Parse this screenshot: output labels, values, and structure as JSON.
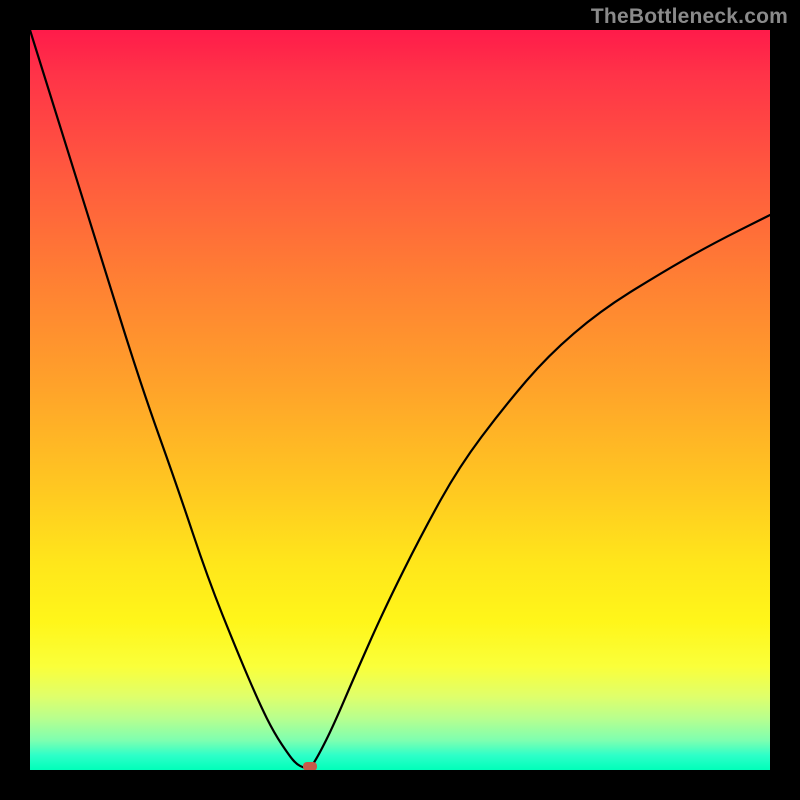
{
  "watermark": "TheBottleneck.com",
  "colors": {
    "background": "#000000",
    "curve": "#000000",
    "marker": "#c65a4a",
    "gradient_top": "#ff1b4a",
    "gradient_bottom": "#00ffba"
  },
  "chart_data": {
    "type": "line",
    "title": "",
    "xlabel": "",
    "ylabel": "",
    "xlim": [
      0,
      100
    ],
    "ylim": [
      0,
      100
    ],
    "grid": false,
    "legend": false,
    "series": [
      {
        "name": "bottleneck-curve",
        "x": [
          0,
          5,
          10,
          15,
          20,
          24,
          28,
          31,
          33,
          35,
          36,
          37,
          37.8,
          39,
          41,
          44,
          48,
          53,
          58,
          64,
          70,
          77,
          85,
          92,
          100
        ],
        "values": [
          100,
          84,
          68,
          52,
          38,
          26,
          16,
          9,
          5,
          2,
          0.8,
          0.3,
          0.1,
          2,
          6,
          13,
          22,
          32,
          41,
          49,
          56,
          62,
          67,
          71,
          75
        ]
      }
    ],
    "annotations": [
      {
        "name": "min-marker",
        "x": 37.8,
        "y": 0.5
      }
    ]
  }
}
